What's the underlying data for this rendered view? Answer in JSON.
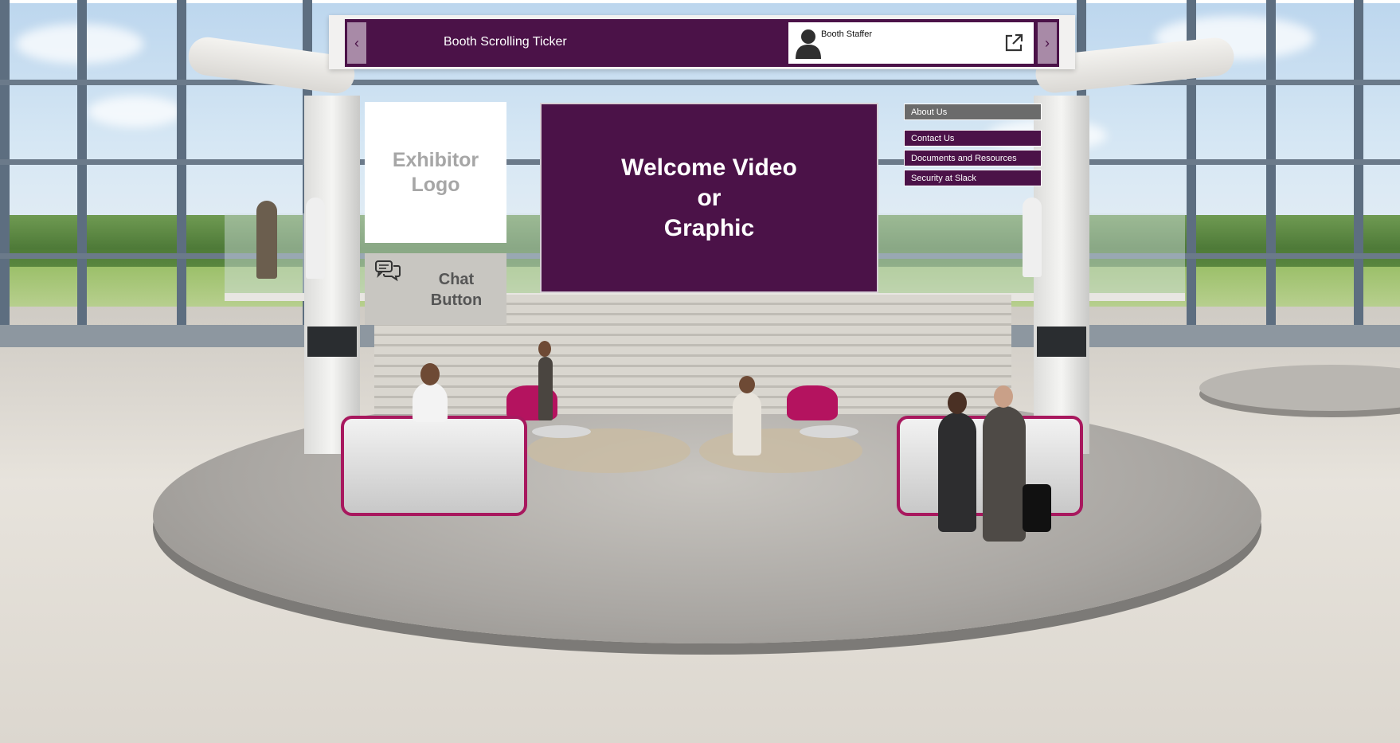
{
  "ticker": {
    "label": "Booth Scrolling Ticker",
    "prev_arrow": "‹",
    "next_arrow": "›"
  },
  "staffer": {
    "name": "Booth Staffer",
    "icon": "person-silhouette-icon",
    "link_icon": "external-link-icon"
  },
  "logo": {
    "text": "Exhibitor\nLogo"
  },
  "chat": {
    "label": "Chat\nButton",
    "icon": "chat-bubbles-icon"
  },
  "video": {
    "text": "Welcome Video\nor\nGraphic"
  },
  "menu": {
    "items": [
      {
        "label": "About Us",
        "active": true
      },
      {
        "label": "Contact Us",
        "active": false
      },
      {
        "label": "Documents and Resources",
        "active": false
      },
      {
        "label": "Security at Slack",
        "active": false
      }
    ]
  },
  "colors": {
    "brand_purple": "#4b1248",
    "arrow_bg": "#a88aa7",
    "accent_magenta": "#a8185e",
    "menu_active": "#6b6b6b"
  }
}
